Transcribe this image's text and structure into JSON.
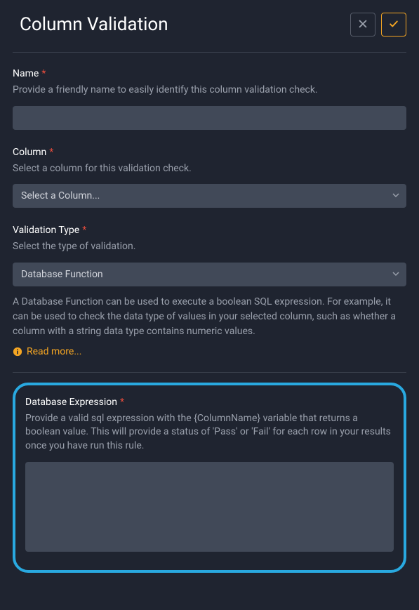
{
  "header": {
    "title": "Column Validation"
  },
  "name": {
    "label": "Name",
    "help": "Provide a friendly name to easily identify this column validation check.",
    "value": ""
  },
  "column": {
    "label": "Column",
    "help": "Select a column for this validation check.",
    "placeholder": "Select a Column..."
  },
  "validation_type": {
    "label": "Validation Type",
    "help": "Select the type of validation.",
    "selected": "Database Function"
  },
  "description": "A Database Function can be used to execute a boolean SQL expression. For example, it can be used to check the data type of values in your selected column, such as whether a column with a string data type contains numeric values.",
  "read_more": "Read more...",
  "expression": {
    "label": "Database Expression",
    "help": "Provide a valid sql expression with the {ColumnName} variable that returns a boolean value. This will provide a status of 'Pass' or 'Fail' for each row in your results once you have run this rule.",
    "value": ""
  },
  "required_marker": "*"
}
